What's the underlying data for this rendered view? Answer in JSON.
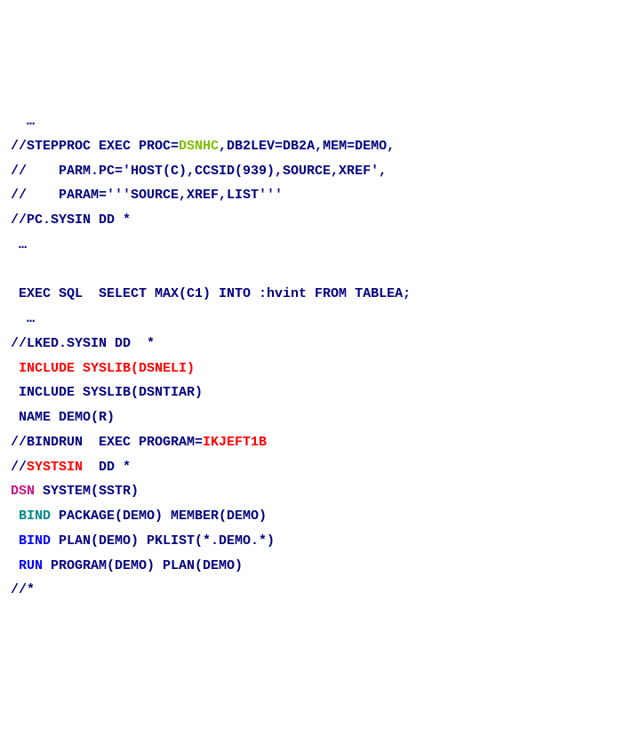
{
  "lines": {
    "l0": "  …",
    "l1a": "//STEPPROC EXEC PROC=",
    "l1b": "DSNHC",
    "l1c": ",DB2LEV=DB2A,MEM=DEMO,",
    "l2": "//    PARM.PC='HOST(C),CCSID(939),SOURCE,XREF',",
    "l3": "//    PARAM='''SOURCE,XREF,LIST'''",
    "l4": "//PC.SYSIN DD *",
    "l5": " …",
    "l6": " ",
    "l7": " EXEC SQL  SELECT MAX(C1) INTO :hvint FROM TABLEA;",
    "l8": "  …",
    "l9": "//LKED.SYSIN DD  *",
    "l10": " INCLUDE SYSLIB(DSNELI)",
    "l11": " INCLUDE SYSLIB(DSNTIAR)",
    "l12": " NAME DEMO(R)",
    "l13a": "//BINDRUN  EXEC PROGRAM=",
    "l13b": "IKJEFT1B",
    "l14a": "//",
    "l14b": "SYSTSIN",
    "l14c": "  DD *",
    "l15a": "DSN",
    "l15b": " SYSTEM(SSTR)",
    "l16a": " BIND",
    "l16b": " PACKAGE(DEMO) MEMBER(DEMO)",
    "l17a": " BIND",
    "l17b": " PLAN(DEMO) PKLIST(*.DEMO.*)",
    "l18a": " RUN",
    "l18b": " PROGRAM(DEMO) PLAN(DEMO)",
    "l19": "//*"
  }
}
